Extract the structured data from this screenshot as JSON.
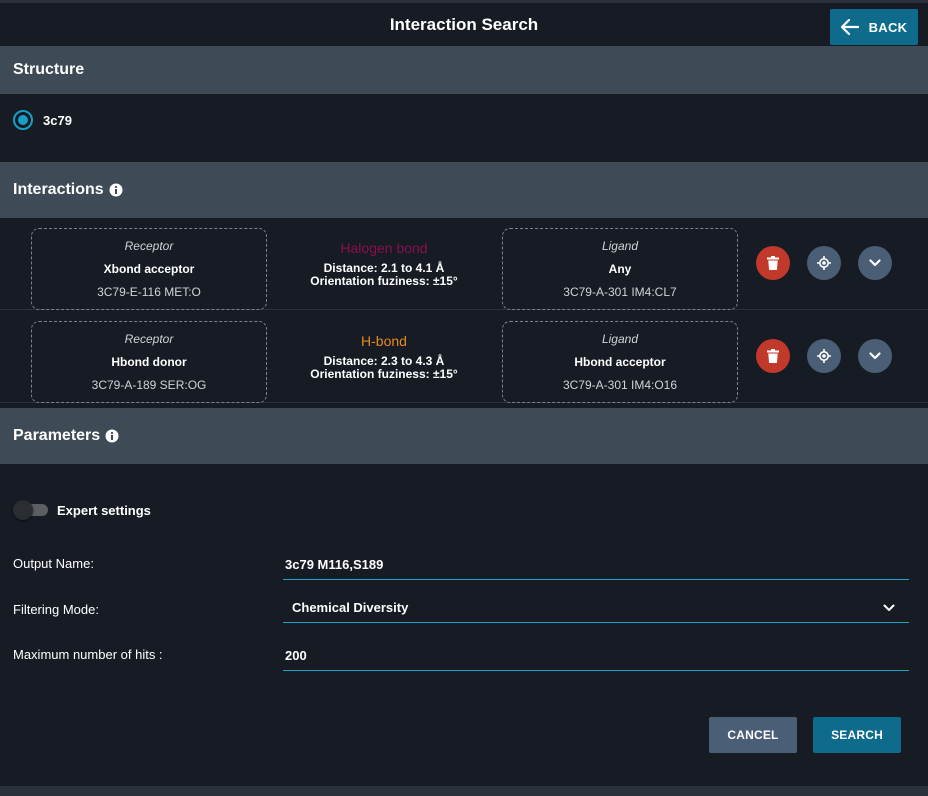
{
  "header": {
    "title": "Interaction Search",
    "back_label": "BACK"
  },
  "structure": {
    "heading": "Structure",
    "selected": "3c79"
  },
  "interactions": {
    "heading": "Interactions",
    "rows": [
      {
        "receptor": {
          "role": "Receptor",
          "type": "Xbond acceptor",
          "atom": "3C79-E-116 MET:O"
        },
        "kind": "Halogen bond",
        "kind_color": "#8b0f4e",
        "distance": "Distance: 2.1 to 4.1 Å",
        "fuzziness": "Orientation fuziness: ±15°",
        "ligand": {
          "role": "Ligand",
          "type": "Any",
          "atom": "3C79-A-301 IM4:CL7"
        }
      },
      {
        "receptor": {
          "role": "Receptor",
          "type": "Hbond donor",
          "atom": "3C79-A-189 SER:OG"
        },
        "kind": "H-bond",
        "kind_color": "#e8891a",
        "distance": "Distance: 2.3 to 4.3 Å",
        "fuzziness": "Orientation fuziness: ±15°",
        "ligand": {
          "role": "Ligand",
          "type": "Hbond acceptor",
          "atom": "3C79-A-301 IM4:O16"
        }
      }
    ]
  },
  "parameters": {
    "heading": "Parameters",
    "expert_label": "Expert settings",
    "expert_enabled": false,
    "output_name_label": "Output Name:",
    "output_name_value": "3c79 M116,S189",
    "filtering_label": "Filtering Mode:",
    "filtering_value": "Chemical Diversity",
    "max_hits_label": "Maximum number of hits :",
    "max_hits_value": "200"
  },
  "actions": {
    "cancel_label": "CANCEL",
    "search_label": "SEARCH"
  },
  "colors": {
    "accent": "#0e6b8c",
    "delete": "#c0392b",
    "secondary": "#4a5e75",
    "section_bg": "#3e4a55",
    "page_bg": "#161b24"
  }
}
